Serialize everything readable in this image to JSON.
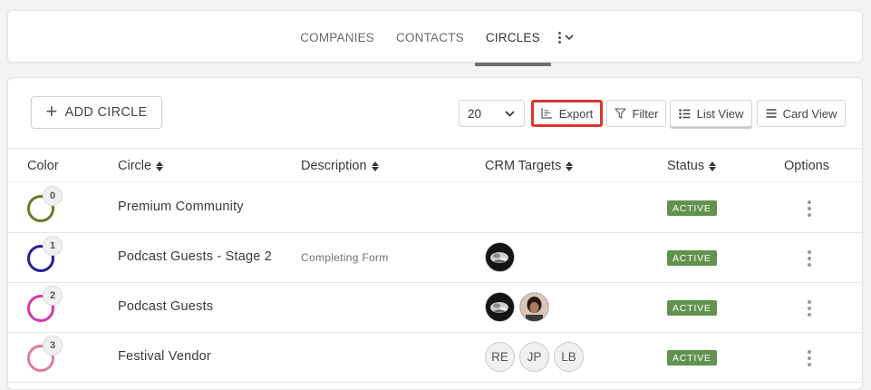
{
  "nav": {
    "tabs": [
      {
        "label": "COMPANIES",
        "active": false
      },
      {
        "label": "CONTACTS",
        "active": false
      },
      {
        "label": "CIRCLES",
        "active": true
      }
    ],
    "more_icon": "kebab-chevron-icon"
  },
  "toolbar": {
    "add_label": "ADD CIRCLE",
    "page_size": "20",
    "export_label": "Export",
    "filter_label": "Filter",
    "list_view_label": "List View",
    "card_view_label": "Card View",
    "highlight_color": "#e0332f"
  },
  "table": {
    "headers": {
      "color": "Color",
      "circle": "Circle",
      "description": "Description",
      "crm_targets": "CRM Targets",
      "status": "Status",
      "options": "Options"
    },
    "rows": [
      {
        "index": "0",
        "ring_color": "#6b7a2a",
        "name": "Premium Community",
        "description": "",
        "targets": [],
        "status": "ACTIVE"
      },
      {
        "index": "1",
        "ring_color": "#2a1f8f",
        "name": "Podcast Guests - Stage 2",
        "description": "Completing Form",
        "targets": [
          {
            "type": "photo",
            "name": "photo-avatar-icon"
          }
        ],
        "status": "ACTIVE"
      },
      {
        "index": "2",
        "ring_color": "#d23aa8",
        "name": "Podcast Guests",
        "description": "",
        "targets": [
          {
            "type": "photo",
            "name": "photo-avatar-icon"
          },
          {
            "type": "photo2",
            "name": "person-photo-avatar-icon"
          }
        ],
        "status": "ACTIVE"
      },
      {
        "index": "3",
        "ring_color": "#e07aa0",
        "name": "Festival Vendor",
        "description": "",
        "targets": [
          {
            "type": "initials",
            "text": "RE"
          },
          {
            "type": "initials",
            "text": "JP"
          },
          {
            "type": "initials",
            "text": "LB"
          }
        ],
        "status": "ACTIVE"
      }
    ],
    "status_color": "#61934e"
  }
}
